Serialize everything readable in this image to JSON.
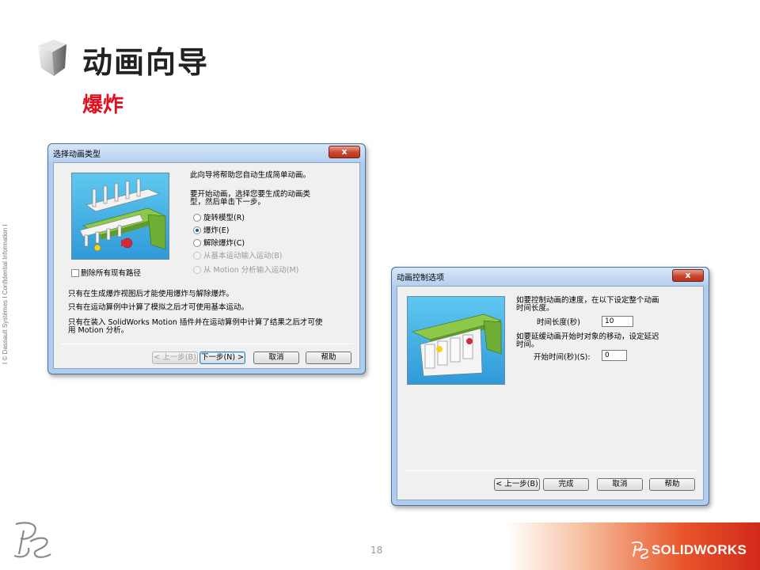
{
  "slide": {
    "title": "动画向导",
    "subtitle": "爆炸",
    "side_text": "I © Dassault Systèmes I Confidential Information I",
    "page_number": "18",
    "brand": "SOLIDWORKS"
  },
  "dialog1": {
    "title": "选择动画类型",
    "close": "x",
    "intro": "此向导将帮助您自动生成简单动画。",
    "prompt_line1": "要开始动画，选择您要生成的动画类",
    "prompt_line2": "型，然后单击下一步。",
    "options": [
      {
        "label": "旋转模型(R)",
        "checked": false,
        "enabled": true
      },
      {
        "label": "爆炸(E)",
        "checked": true,
        "enabled": true
      },
      {
        "label": "解除爆炸(C)",
        "checked": false,
        "enabled": true
      },
      {
        "label": "从基本运动输入运动(B)",
        "checked": false,
        "enabled": false
      },
      {
        "label": "从 Motion 分析输入运动(M)",
        "checked": false,
        "enabled": false
      }
    ],
    "checkbox_label": "删除所有现有路径",
    "note1": "只有在生成爆炸视图后才能使用爆炸与解除爆炸。",
    "note2": "只有在运动算例中计算了模拟之后才可使用基本运动。",
    "note3_line1": "只有在装入 SolidWorks Motion 插件并在运动算例中计算了结果之后才可使",
    "note3_line2": "用 Motion 分析。",
    "buttons": {
      "back": "< 上一步(B)",
      "next": "下一步(N) >",
      "cancel": "取消",
      "help": "帮助"
    }
  },
  "dialog2": {
    "title": "动画控制选项",
    "close": "x",
    "speed_line1": "如要控制动画的速度，在以下设定整个动画",
    "speed_line2": "时间长度。",
    "duration_label": "时间长度(秒)",
    "duration_value": "10",
    "delay_line1": "如要延缓动画开始时对象的移动，设定延迟",
    "delay_line2": "时间。",
    "start_label": "开始时间(秒)(S):",
    "start_value": "0",
    "buttons": {
      "back": "< 上一步(B)",
      "finish": "完成",
      "cancel": "取消",
      "help": "帮助"
    }
  }
}
